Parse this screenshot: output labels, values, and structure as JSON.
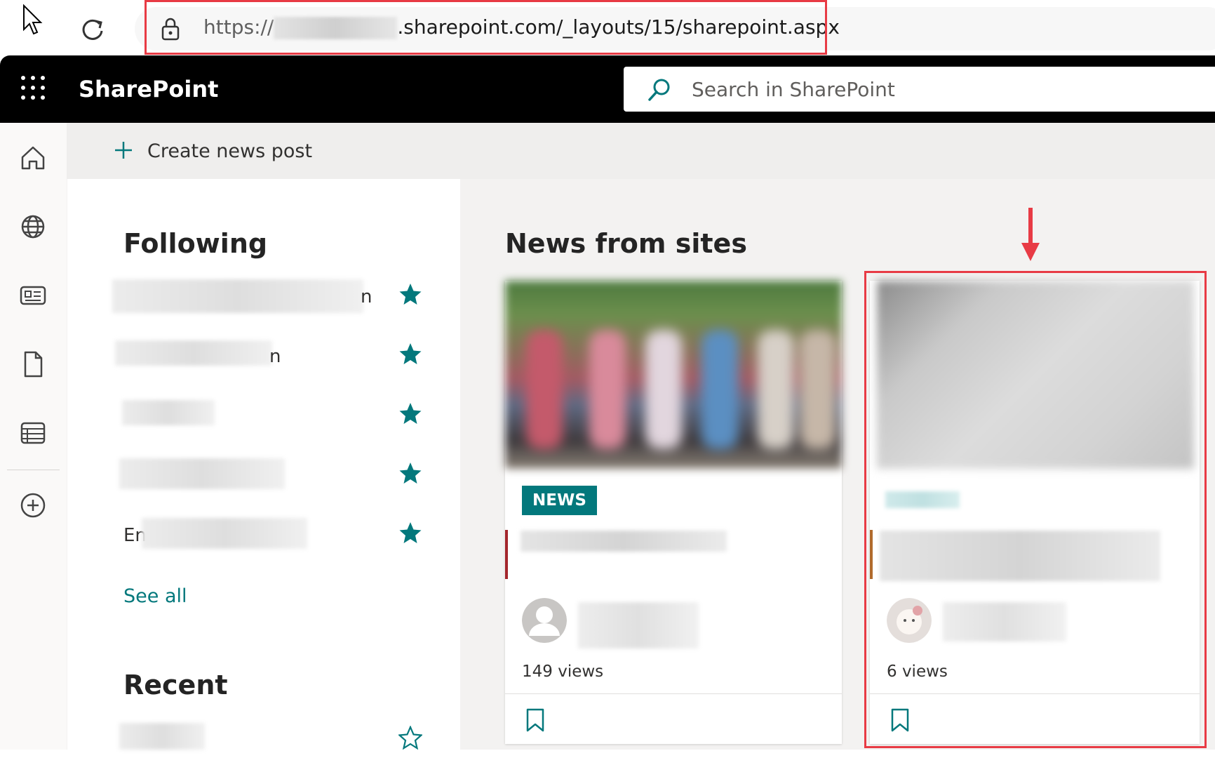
{
  "browser": {
    "url_prefix": "https://",
    "url_suffix": ".sharepoint.com/_layouts/15/sharepoint.aspx"
  },
  "suite": {
    "brand": "SharePoint",
    "search_placeholder": "Search in SharePoint"
  },
  "command_bar": {
    "create_label": "Create news post"
  },
  "following": {
    "title": "Following",
    "items": [
      {
        "visible_text": "n"
      },
      {
        "visible_text": "n"
      },
      {
        "visible_text": ""
      },
      {
        "visible_text": ""
      },
      {
        "visible_text": "En"
      }
    ],
    "see_all": "See all"
  },
  "recent": {
    "title": "Recent"
  },
  "news": {
    "title": "News from sites",
    "cards": [
      {
        "badge": "NEWS",
        "views": "149 views"
      },
      {
        "views": "6 views"
      }
    ]
  },
  "colors": {
    "accent": "#03787c",
    "highlight": "#e83b45",
    "suite_bar": "#000000"
  }
}
